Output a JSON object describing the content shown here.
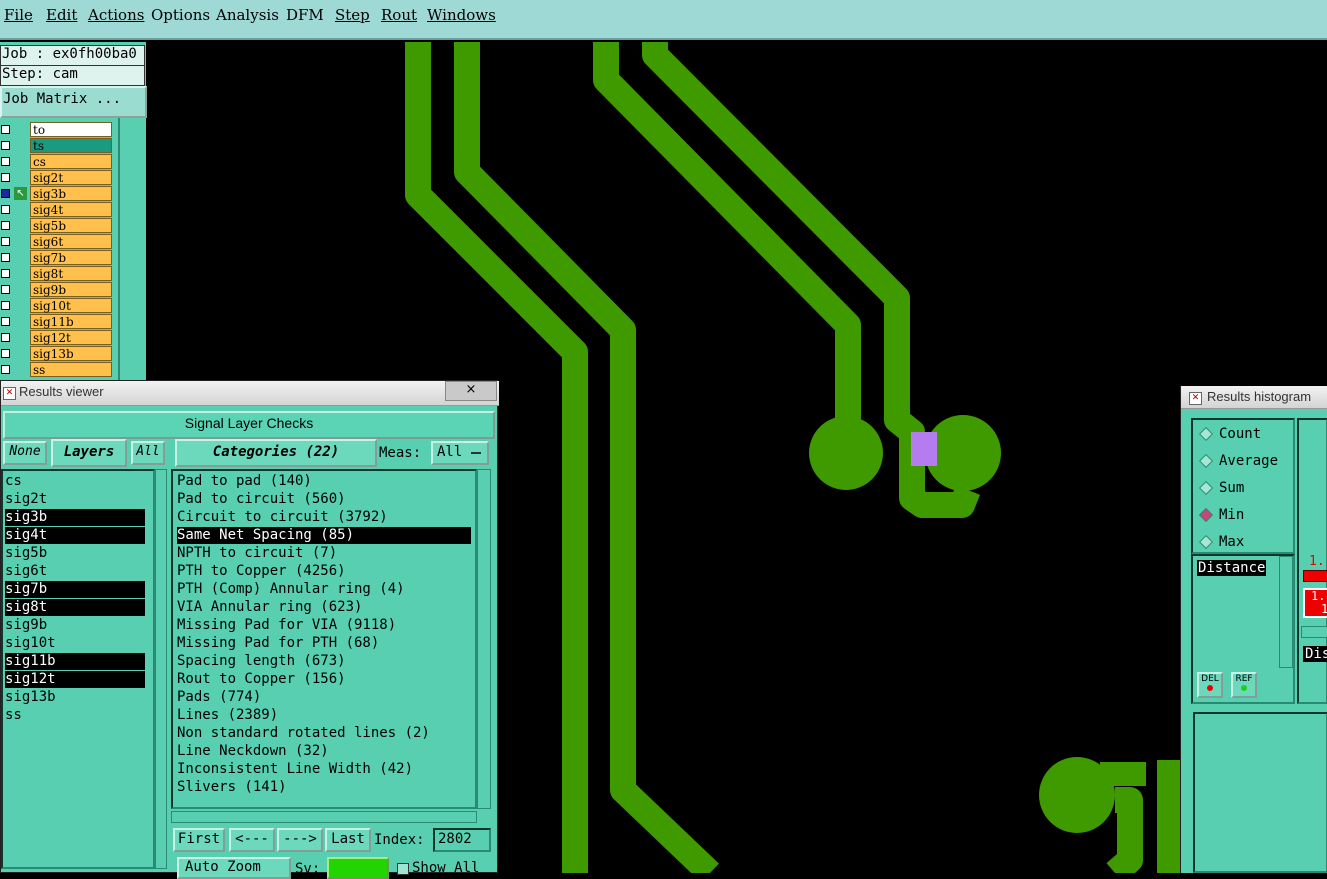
{
  "menu": [
    "File",
    "Edit",
    "Actions",
    "Options",
    "Analysis",
    "DFM",
    "Step",
    "Rout",
    "Windows"
  ],
  "job": {
    "job_label": "Job : ex0fh00ba0",
    "step_label": "Step: cam",
    "matrix_button": "Job Matrix ..."
  },
  "layers": [
    "to",
    "ts",
    "cs",
    "sig2t",
    "sig3b",
    "sig4t",
    "sig5b",
    "sig6t",
    "sig7b",
    "sig8t",
    "sig9b",
    "sig10t",
    "sig11b",
    "sig12t",
    "sig13b",
    "ss"
  ],
  "results_viewer": {
    "title": "Results viewer",
    "close": "×",
    "header": "Signal Layer Checks",
    "none_btn": "None",
    "layers_btn": "Layers",
    "all_btn": "All",
    "categories_btn": "Categories (22)",
    "meas_label": "Meas:",
    "meas_value": "All",
    "layer_list": [
      "cs",
      "sig2t",
      "sig3b",
      "sig4t",
      "sig5b",
      "sig6t",
      "sig7b",
      "sig8t",
      "sig9b",
      "sig10t",
      "sig11b",
      "sig12t",
      "sig13b",
      "ss"
    ],
    "categories": [
      "Pad to pad (140)",
      "Pad to circuit (560)",
      "Circuit to circuit (3792)",
      "Same Net Spacing (85)",
      "NPTH to circuit (7)",
      "PTH to Copper (4256)",
      "PTH (Comp) Annular ring (4)",
      "VIA Annular ring (623)",
      "Missing Pad for VIA (9118)",
      "Missing Pad for PTH (68)",
      "Spacing length (673)",
      "Rout to Copper (156)",
      "Pads (774)",
      "Lines (2389)",
      "Non standard rotated lines (2)",
      "Line Neckdown (32)",
      "Inconsistent Line Width (42)",
      "Slivers (141)"
    ],
    "nav": {
      "first": "First",
      "prev": "<---",
      "next": "--->",
      "last": "Last",
      "index_label": "Index:",
      "index_value": "2802"
    },
    "auto_zoom": "Auto Zoom",
    "sv_label": "Sv:",
    "show_all": "Show All"
  },
  "histogram": {
    "title": "Results histogram",
    "options": [
      "Count",
      "Average",
      "Sum",
      "Min",
      "Max"
    ],
    "selected": "Min",
    "list_item": "Distance",
    "del": "DEL",
    "ref": "REF",
    "partial_1": "1.",
    "partial_2": "1.",
    "partial_3": "1",
    "partial_dis": "Dis"
  }
}
